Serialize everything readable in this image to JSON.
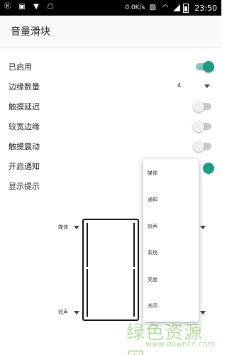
{
  "status_bar": {
    "network_speed": "0.0K/s",
    "time": "23:50",
    "icons": [
      "k-badge-icon",
      "image-icon",
      "caret-down-icon",
      "ghost-icon",
      "no-sim-icon",
      "wifi-icon",
      "signal-icon",
      "battery-icon"
    ]
  },
  "app_bar": {
    "title": "音量滑块"
  },
  "settings": {
    "enabled": {
      "label": "已启用",
      "on": true
    },
    "edge_count": {
      "label": "边缘数量",
      "value": "4"
    },
    "touch_delay": {
      "label": "触摸延迟",
      "on": false
    },
    "wider_edge": {
      "label": "较宽边缘",
      "on": false
    },
    "touch_vibrate": {
      "label": "触摸震动",
      "on": false
    },
    "notification": {
      "label": "开启通知",
      "on": true
    },
    "show_hint": {
      "label": "显示提示"
    }
  },
  "preview": {
    "top_label": "媒体",
    "bottom_label": "铃声"
  },
  "popup_menu": {
    "items": [
      "媒体",
      "通知",
      "铃声",
      "系统",
      "亮度",
      "关闭"
    ]
  },
  "watermark": {
    "text": "绿色资源网",
    "url": "www.downcc.com"
  },
  "colors": {
    "accent": "#1e9b86",
    "accent_track": "#86c6bd",
    "toggle_off_track": "#c8c8c8"
  }
}
